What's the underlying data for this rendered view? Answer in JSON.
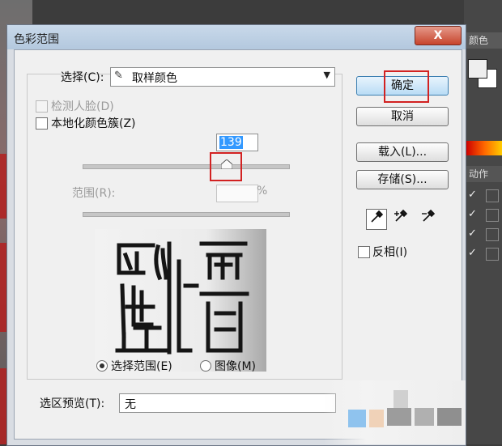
{
  "dialog": {
    "title": "色彩范围",
    "close_label": "X"
  },
  "select": {
    "label": "选择(C):",
    "value": "取样颜色",
    "icon": "eyedropper-icon"
  },
  "options": {
    "detect_faces": "检测人脸(D)",
    "localized_clusters": "本地化颜色簇(Z)"
  },
  "fuzziness": {
    "value": "139"
  },
  "range": {
    "label": "范围(R):",
    "unit": "%"
  },
  "view_mode": {
    "selection": "选择范围(E)",
    "image": "图像(M)",
    "selected": "selection"
  },
  "selection_preview": {
    "label": "选区预览(T):",
    "value": "无"
  },
  "buttons": {
    "ok": "确定",
    "cancel": "取消",
    "load": "载入(L)...",
    "save": "存储(S)..."
  },
  "tools": [
    "eyedropper-icon",
    "eyedropper-plus-icon",
    "eyedropper-minus-icon"
  ],
  "invert": {
    "label": "反相(I)"
  },
  "panel": {
    "color_tab": "颜色",
    "actions_tab": "动作",
    "accent_red": "#d22222"
  }
}
